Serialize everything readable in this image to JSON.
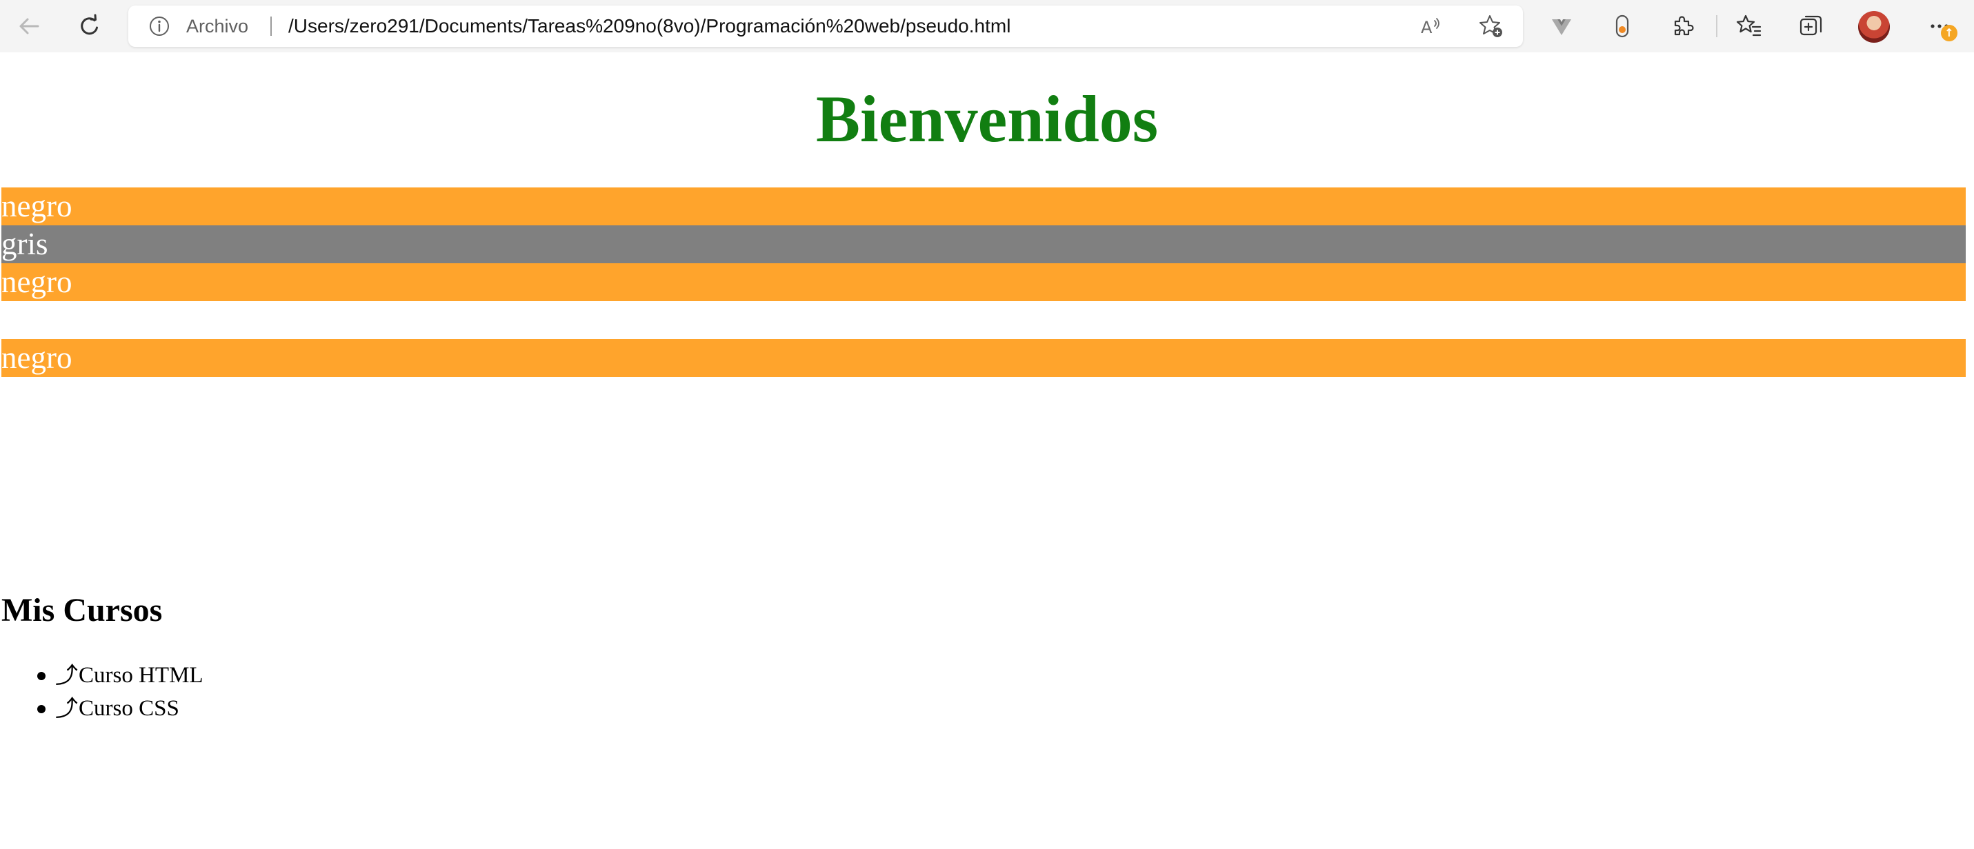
{
  "browser": {
    "address": {
      "scheme_label": "Archivo",
      "url": "/Users/zero291/Documents/Tareas%209no(8vo)/Programación%20web/pseudo.html"
    },
    "icons": {
      "back": "arrow-left-icon",
      "reload": "reload-icon",
      "info": "info-icon",
      "read_aloud": "read-aloud-icon",
      "add_favorite": "star-plus-icon",
      "extension_1": "vue-devtools-icon",
      "extension_2": "extension-pill-icon",
      "extensions": "puzzle-icon",
      "favorites": "favorites-icon",
      "collections": "collections-icon",
      "profile": "avatar",
      "menu": "more-icon"
    },
    "update_badge": "↑",
    "colors": {
      "toolbar_bg": "#f4f4f4",
      "address_bg": "#ffffff",
      "badge": "#f5a623"
    }
  },
  "page": {
    "title": "Bienvenidos",
    "title_color": "#117e11",
    "bands": [
      {
        "text": "negro",
        "color": "#ffa42c"
      },
      {
        "text": "gris",
        "color": "#808080"
      },
      {
        "text": "negro",
        "color": "#ffa42c"
      },
      {
        "text": "",
        "color": "#ffffff"
      },
      {
        "text": "negro",
        "color": "#ffa42c"
      }
    ],
    "courses_heading": "Mis Cursos",
    "courses": [
      {
        "arrow": "⤴",
        "label": "Curso HTML"
      },
      {
        "arrow": "⤴",
        "label": "Curso CSS"
      }
    ]
  }
}
